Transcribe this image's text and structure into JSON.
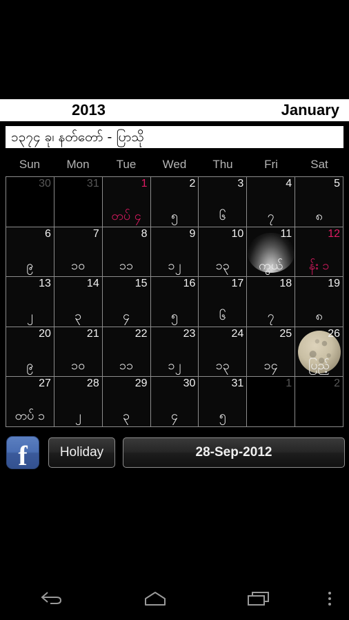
{
  "header": {
    "year": "2013",
    "month": "January",
    "burmese_subtitle": "၁၃၇၄ ခု၊ နတ်တော် - ပြာသို"
  },
  "weekdays": [
    "Sun",
    "Mon",
    "Tue",
    "Wed",
    "Thu",
    "Fri",
    "Sat"
  ],
  "colors": {
    "highlight_pink": "#e01b63",
    "grid_line": "#8d8d8d",
    "cell_bg": "#0a0a0a",
    "text": "#f2f2f2",
    "muted_text": "#585858",
    "facebook_blue": "#3b5a9b"
  },
  "calendar": {
    "rows": [
      [
        {
          "day": "30",
          "burmese": "",
          "other_month": true,
          "pink": false,
          "moon": ""
        },
        {
          "day": "31",
          "burmese": "",
          "other_month": true,
          "pink": false,
          "moon": ""
        },
        {
          "day": "1",
          "burmese": "တပ် ၄",
          "other_month": false,
          "pink": true,
          "moon": ""
        },
        {
          "day": "2",
          "burmese": "၅",
          "other_month": false,
          "pink": false,
          "moon": ""
        },
        {
          "day": "3",
          "burmese": "၆",
          "other_month": false,
          "pink": false,
          "moon": ""
        },
        {
          "day": "4",
          "burmese": "၇",
          "other_month": false,
          "pink": false,
          "moon": ""
        },
        {
          "day": "5",
          "burmese": "၈",
          "other_month": false,
          "pink": false,
          "moon": ""
        }
      ],
      [
        {
          "day": "6",
          "burmese": "၉",
          "other_month": false,
          "pink": false,
          "moon": ""
        },
        {
          "day": "7",
          "burmese": "၁၀",
          "other_month": false,
          "pink": false,
          "moon": ""
        },
        {
          "day": "8",
          "burmese": "၁၁",
          "other_month": false,
          "pink": false,
          "moon": ""
        },
        {
          "day": "9",
          "burmese": "၁၂",
          "other_month": false,
          "pink": false,
          "moon": ""
        },
        {
          "day": "10",
          "burmese": "၁၃",
          "other_month": false,
          "pink": false,
          "moon": ""
        },
        {
          "day": "11",
          "burmese": "ကွယ်",
          "other_month": false,
          "pink": false,
          "moon": "crescent"
        },
        {
          "day": "12",
          "burmese": "န်း ၁",
          "other_month": false,
          "pink": true,
          "moon": ""
        }
      ],
      [
        {
          "day": "13",
          "burmese": "၂",
          "other_month": false,
          "pink": false,
          "moon": ""
        },
        {
          "day": "14",
          "burmese": "၃",
          "other_month": false,
          "pink": false,
          "moon": ""
        },
        {
          "day": "15",
          "burmese": "၄",
          "other_month": false,
          "pink": false,
          "moon": ""
        },
        {
          "day": "16",
          "burmese": "၅",
          "other_month": false,
          "pink": false,
          "moon": ""
        },
        {
          "day": "17",
          "burmese": "၆",
          "other_month": false,
          "pink": false,
          "moon": ""
        },
        {
          "day": "18",
          "burmese": "၇",
          "other_month": false,
          "pink": false,
          "moon": ""
        },
        {
          "day": "19",
          "burmese": "၈",
          "other_month": false,
          "pink": false,
          "moon": ""
        }
      ],
      [
        {
          "day": "20",
          "burmese": "၉",
          "other_month": false,
          "pink": false,
          "moon": ""
        },
        {
          "day": "21",
          "burmese": "၁၀",
          "other_month": false,
          "pink": false,
          "moon": ""
        },
        {
          "day": "22",
          "burmese": "၁၁",
          "other_month": false,
          "pink": false,
          "moon": ""
        },
        {
          "day": "23",
          "burmese": "၁၂",
          "other_month": false,
          "pink": false,
          "moon": ""
        },
        {
          "day": "24",
          "burmese": "၁၃",
          "other_month": false,
          "pink": false,
          "moon": ""
        },
        {
          "day": "25",
          "burmese": "၁၄",
          "other_month": false,
          "pink": false,
          "moon": ""
        },
        {
          "day": "26",
          "burmese": "ပြည့်",
          "other_month": false,
          "pink": false,
          "moon": "full"
        }
      ],
      [
        {
          "day": "27",
          "burmese": "တပ် ၁",
          "other_month": false,
          "pink": false,
          "moon": ""
        },
        {
          "day": "28",
          "burmese": "၂",
          "other_month": false,
          "pink": false,
          "moon": ""
        },
        {
          "day": "29",
          "burmese": "၃",
          "other_month": false,
          "pink": false,
          "moon": ""
        },
        {
          "day": "30",
          "burmese": "၄",
          "other_month": false,
          "pink": false,
          "moon": ""
        },
        {
          "day": "31",
          "burmese": "၅",
          "other_month": false,
          "pink": false,
          "moon": ""
        },
        {
          "day": "1",
          "burmese": "",
          "other_month": true,
          "pink": false,
          "moon": ""
        },
        {
          "day": "2",
          "burmese": "",
          "other_month": true,
          "pink": false,
          "moon": ""
        }
      ]
    ]
  },
  "toolbar": {
    "facebook_icon": "facebook-icon",
    "facebook_glyph": "f",
    "holiday_label": "Holiday",
    "date_label": "28-Sep-2012"
  },
  "navbar": {
    "back": "back-icon",
    "home": "home-icon",
    "recents": "recents-icon",
    "overflow": "overflow-menu-icon"
  }
}
